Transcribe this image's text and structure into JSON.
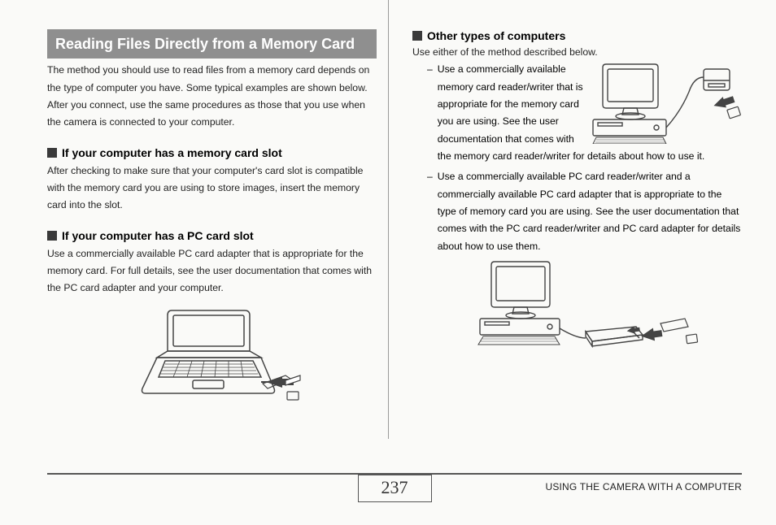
{
  "title": "Reading Files Directly from a Memory Card",
  "intro": "The method you should use to read files from a memory card depends on the type of computer you have. Some typical examples are shown below. After you connect, use the same procedures as those that you use when the camera is connected to your computer.",
  "left_sections": [
    {
      "heading": "If your computer has a memory card slot",
      "body": "After checking to make sure that your computer's card slot is compatible with the memory card you are using to store images, insert the memory card into the slot."
    },
    {
      "heading": "If your computer has a PC card slot",
      "body": "Use a commercially available PC card adapter that is appropriate for the memory card. For full details, see the user documentation that comes with the PC card adapter and your computer."
    }
  ],
  "right_heading": "Other types of computers",
  "right_intro": "Use either of the method described below.",
  "right_items": [
    {
      "lead": "Use a commercially available memory card reader/writer that is appropriate for the memory card you are using. See the user",
      "tail": "documentation that comes with the memory card reader/writer for details about how to use it."
    },
    {
      "lead": "Use a commercially available PC card reader/writer and a commercially available PC card adapter that is appropriate to the type of memory card you are using. See the user documentation that comes with the PC card reader/writer and PC card adapter for details about how to use them.",
      "tail": ""
    }
  ],
  "page_number": "237",
  "footer_label": "USING THE CAMERA WITH A COMPUTER"
}
